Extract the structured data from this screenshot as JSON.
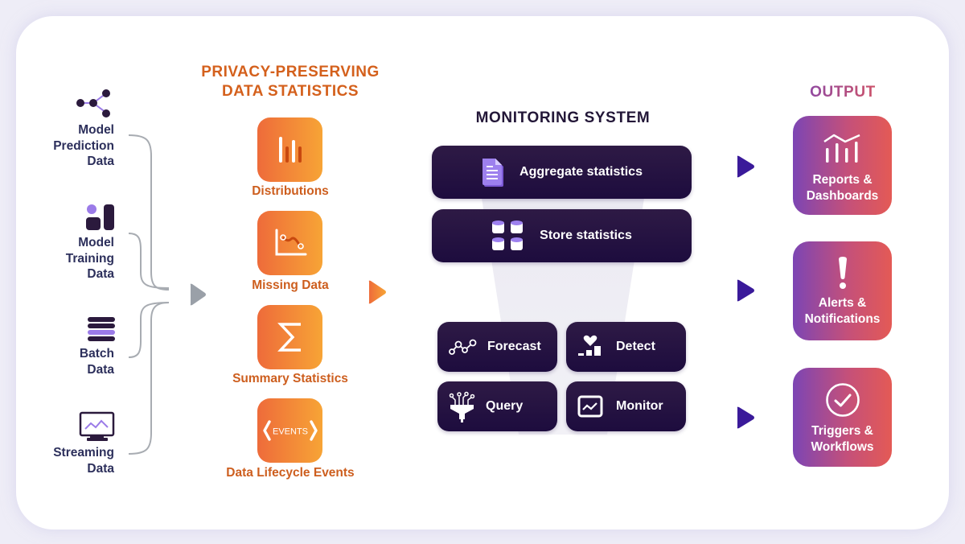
{
  "inputs": {
    "items": [
      {
        "label": "Model\nPrediction\nData",
        "icon": "network-nodes-icon"
      },
      {
        "label": "Model\nTraining\nData",
        "icon": "training-shapes-icon"
      },
      {
        "label": "Batch\nData",
        "icon": "stack-layers-icon"
      },
      {
        "label": "Streaming\nData",
        "icon": "monitor-chart-icon"
      }
    ]
  },
  "statistics": {
    "heading": "PRIVACY-PRESERVING\nDATA STATISTICS",
    "items": [
      {
        "label": "Distributions",
        "icon": "bar-distribution-icon"
      },
      {
        "label": "Missing Data",
        "icon": "line-chart-gap-icon"
      },
      {
        "label": "Summary Statistics",
        "icon": "sigma-icon"
      },
      {
        "label": "Data Lifecycle Events",
        "icon": "events-brackets-icon",
        "icon_text": "EVENTS"
      }
    ]
  },
  "monitoring": {
    "heading": "MONITORING SYSTEM",
    "bars": [
      {
        "label": "Aggregate statistics",
        "icon": "document-icon"
      },
      {
        "label": "Store statistics",
        "icon": "databases-icon"
      }
    ],
    "actions": [
      {
        "label": "Forecast",
        "icon": "forecast-nodes-icon"
      },
      {
        "label": "Detect",
        "icon": "detect-heart-icon"
      },
      {
        "label": "Query",
        "icon": "query-funnel-icon"
      },
      {
        "label": "Monitor",
        "icon": "monitor-window-icon"
      }
    ]
  },
  "output": {
    "heading": "OUTPUT",
    "items": [
      {
        "label": "Reports &\nDashboards",
        "icon": "reports-chart-icon"
      },
      {
        "label": "Alerts &\nNotifications",
        "icon": "exclamation-icon"
      },
      {
        "label": "Triggers &\nWorkflows",
        "icon": "check-circle-icon"
      }
    ]
  },
  "colors": {
    "input_text": "#2c2f5b",
    "orange_accent": "#d4601c",
    "dark_panel": "#1d0c3e",
    "purple_accent": "#9b7be8",
    "output_gradient_start": "#7c45b4",
    "output_gradient_end": "#e45a55",
    "arrow_purple": "#3a1a9a",
    "arrow_gray": "#9aa0a8"
  }
}
